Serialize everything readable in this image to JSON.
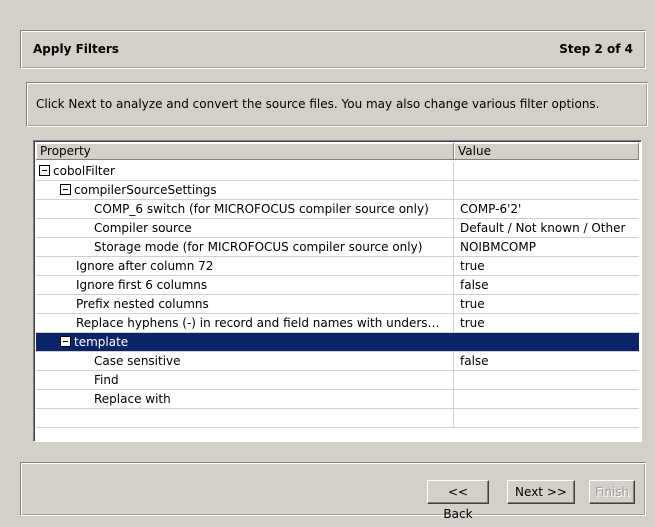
{
  "header": {
    "title": "Apply Filters",
    "step": "Step 2 of 4"
  },
  "instructions": "Click Next to analyze and convert the source files. You may also change various filter options.",
  "table": {
    "columns": {
      "property": "Property",
      "value": "Value"
    },
    "rows": [
      {
        "property": "cobolFilter",
        "value": "",
        "level": 0,
        "expander": "collapse"
      },
      {
        "property": "compilerSourceSettings",
        "value": "",
        "level": 1,
        "expander": "collapse"
      },
      {
        "property": "COMP_6 switch (for MICROFOCUS compiler source only)",
        "value": "COMP-6'2'",
        "level": 2
      },
      {
        "property": "Compiler source",
        "value": "Default / Not known / Other",
        "level": 2
      },
      {
        "property": "Storage mode (for MICROFOCUS compiler source only)",
        "value": "NOIBMCOMP",
        "level": 2
      },
      {
        "property": "Ignore after column 72",
        "value": "true",
        "level": 1
      },
      {
        "property": "Ignore first 6 columns",
        "value": "false",
        "level": 1
      },
      {
        "property": "Prefix nested columns",
        "value": "true",
        "level": 1
      },
      {
        "property": "Replace hyphens (-) in record and field names with unders…",
        "value": "true",
        "level": 1
      },
      {
        "property": "template",
        "value": "",
        "level": 1,
        "expander": "collapse",
        "selected": true
      },
      {
        "property": "Case sensitive",
        "value": "false",
        "level": 2
      },
      {
        "property": "Find",
        "value": "",
        "level": 2
      },
      {
        "property": "Replace with",
        "value": "",
        "level": 2
      }
    ]
  },
  "footer": {
    "back_label": "<< Back",
    "next_label": "Next >>",
    "finish_label": "Finish"
  },
  "colors": {
    "selection": "#0a246a",
    "dialog_bg": "#d4d0c8"
  }
}
